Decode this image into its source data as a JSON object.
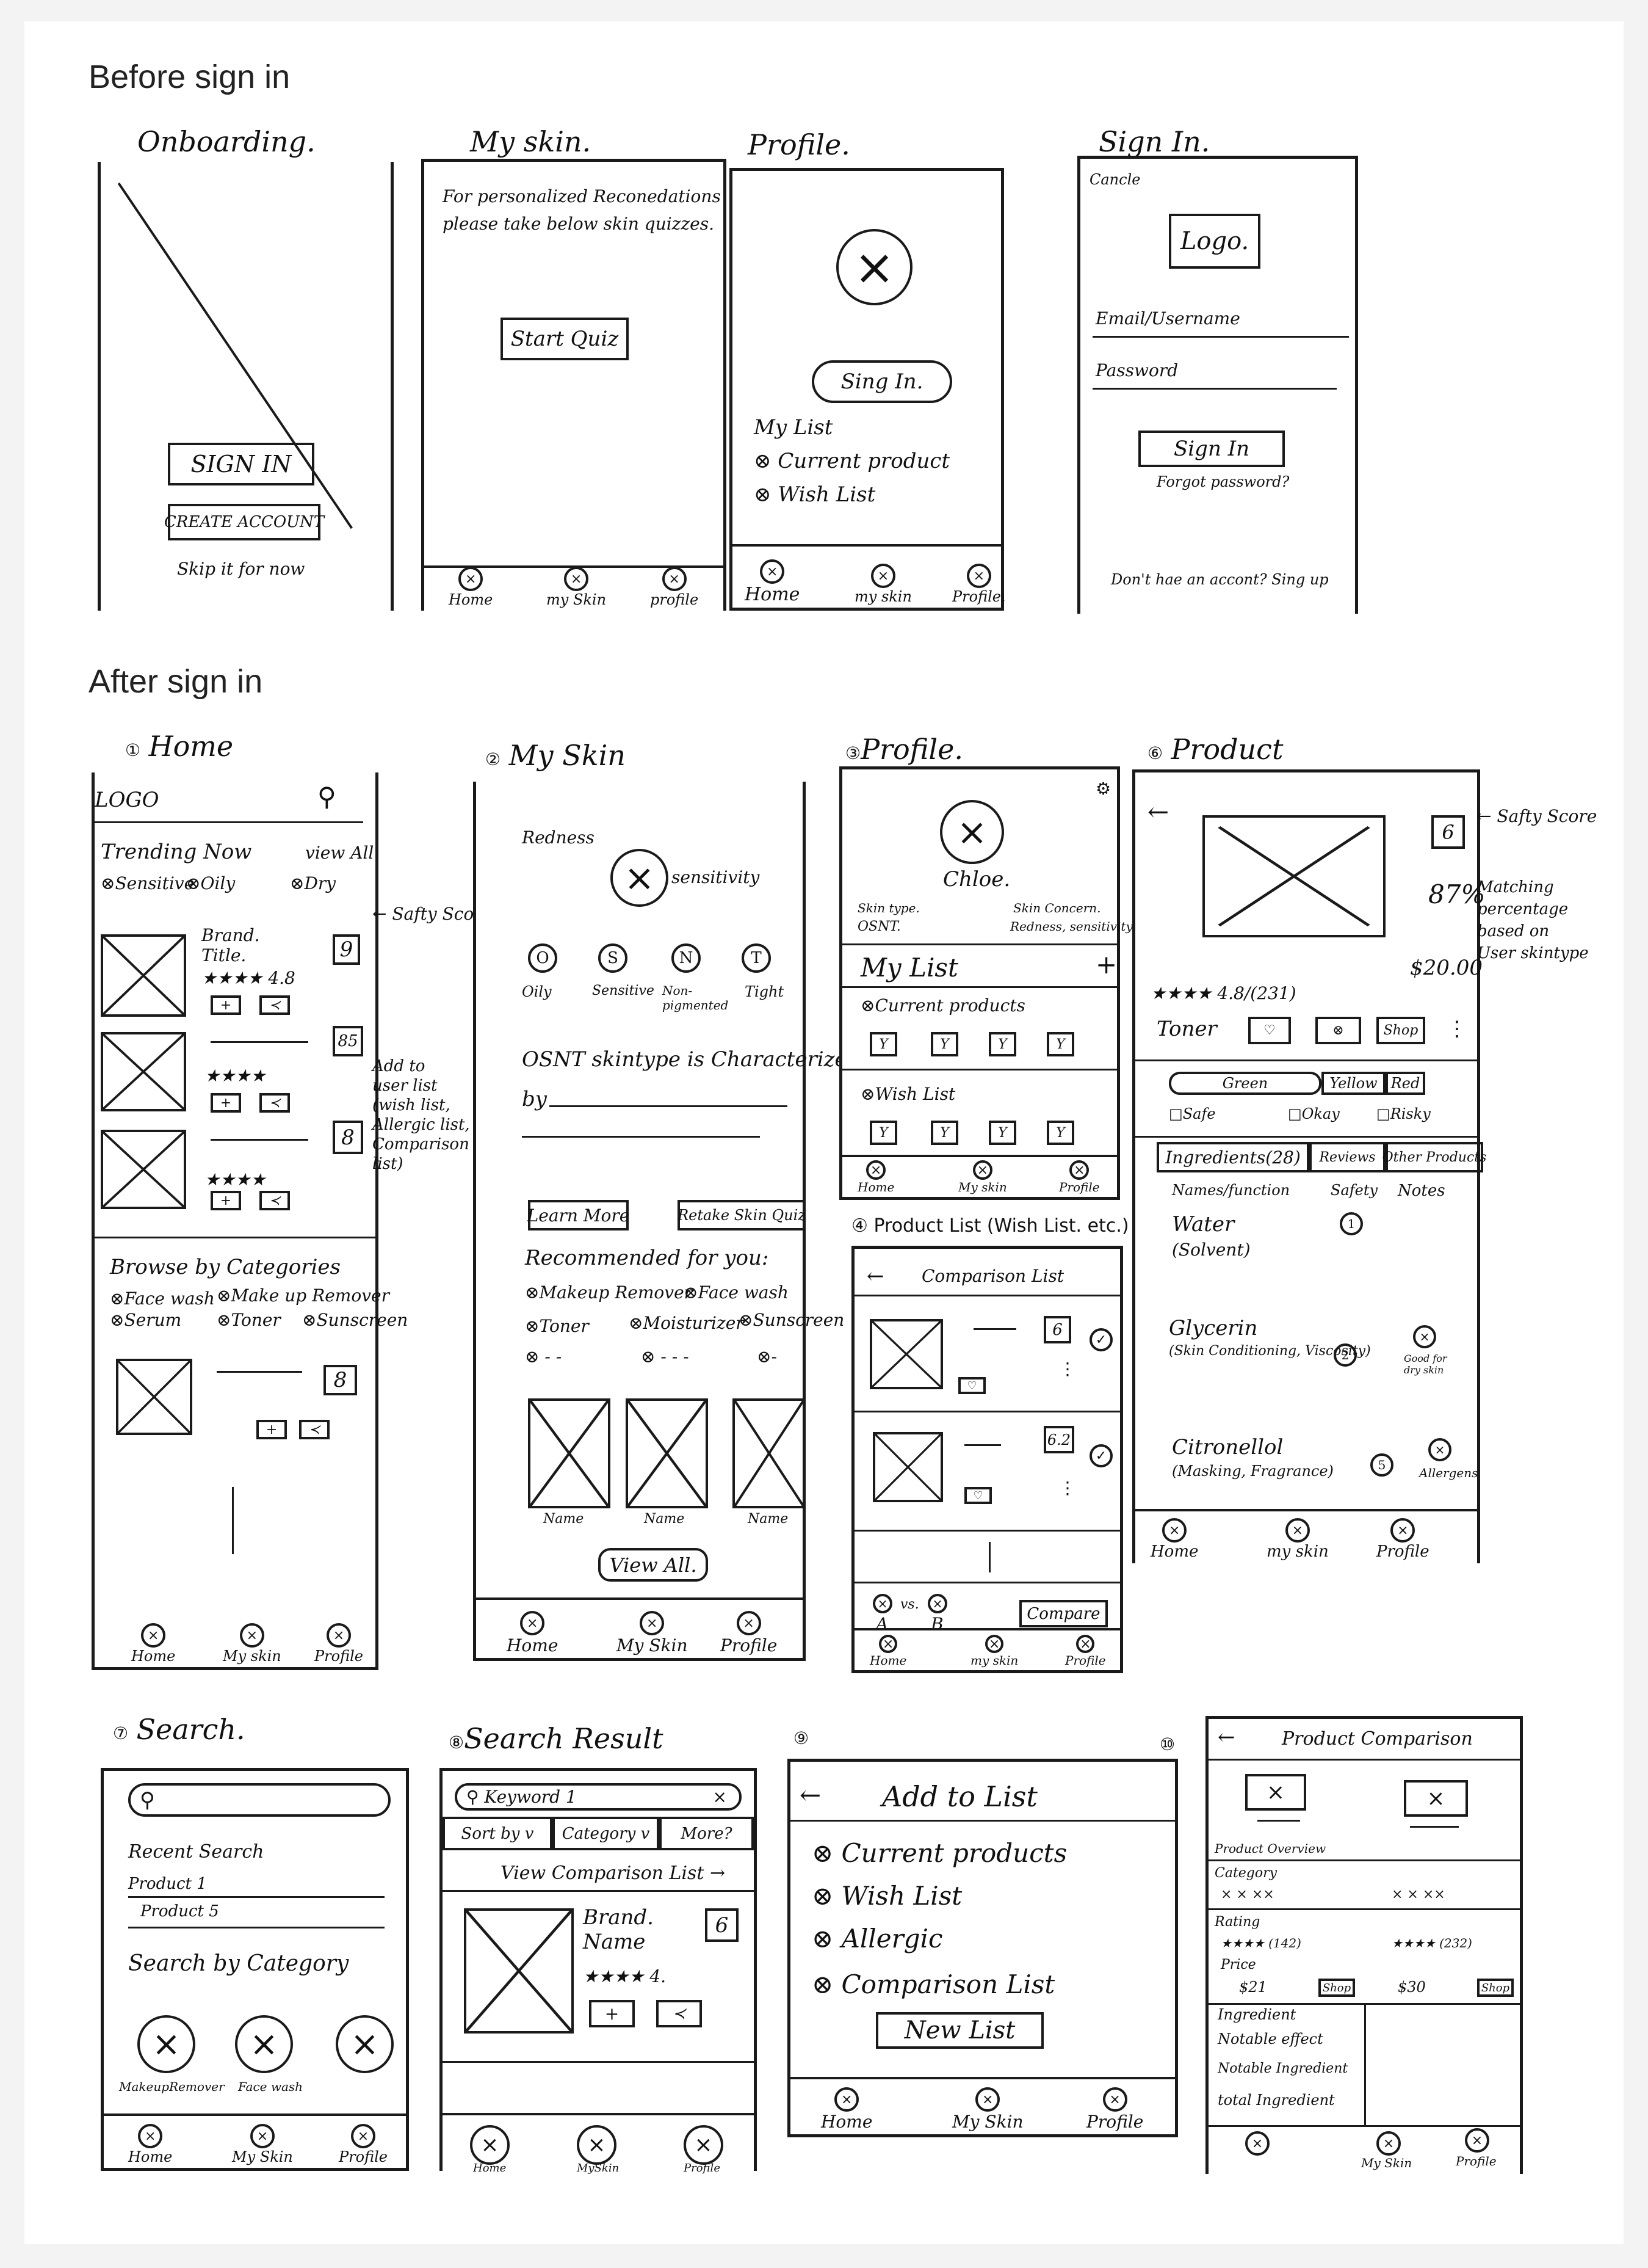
{
  "sections": {
    "before": "Before sign in",
    "after": "After sign in"
  },
  "onboarding": {
    "title": "Onboarding.",
    "sign_in": "SIGN IN",
    "create": "CREATE ACCOUNT",
    "skip": "Skip it for now",
    "nav": [
      "Home",
      "my Skin",
      "profile"
    ]
  },
  "myskin_before": {
    "title": "My skin.",
    "text1": "For personalized Reconedations",
    "text2": "please take below skin quizzes.",
    "start": "Start Quiz"
  },
  "profile_before": {
    "title": "Profile.",
    "sign_in": "Sing In.",
    "list_title": "My List",
    "items": [
      "Current product",
      "Wish List"
    ],
    "nav": [
      "Home",
      "my skin",
      "Profile."
    ]
  },
  "signin": {
    "title": "Sign In.",
    "cancel": "Cancle",
    "logo": "Logo.",
    "email": "Email/Username",
    "password": "Password",
    "button": "Sign In",
    "forgot": "Forgot password?",
    "signup": "Don't hae an accont? Sing up"
  },
  "home": {
    "title": "Home",
    "num": "①",
    "logo": "LOGO",
    "trending": "Trending Now",
    "view_all": "view All",
    "filters": [
      "Sensitive",
      "Oily",
      "Dry"
    ],
    "brand": "Brand.",
    "title_label": "Title.",
    "rating": "4.8",
    "scores": [
      "9",
      "85",
      "8",
      "8"
    ],
    "browse": "Browse by Categories",
    "cats": [
      "Face wash",
      "Make up Remover",
      "Serum",
      "Toner",
      "Sunscreen"
    ],
    "nav": [
      "Home",
      "My skin",
      "Profile"
    ]
  },
  "myskin_after": {
    "title": "My Skin",
    "num": "②",
    "redness": "Redness",
    "sensitivity": "sensitivity",
    "letters": [
      "O",
      "S",
      "N",
      "T"
    ],
    "types": [
      "Oily",
      "Sensitive",
      "Non-pigmented",
      "Tight"
    ],
    "desc": "OSNT skintype is Characterized",
    "by": "by",
    "learn": "Learn More",
    "retake": "Retake Skin Quiz",
    "recommended": "Recommended for you:",
    "cats": [
      "Makeup Remover",
      "Face wash",
      "Toner",
      "Moisturizer",
      "Sunscreen"
    ],
    "name": "Name",
    "view_all": "View All.",
    "nav": [
      "Home",
      "My Skin",
      "Profile"
    ]
  },
  "profile_after": {
    "title": "Profile.",
    "num": "③",
    "name": "Chloe.",
    "skintype_label": "Skin type.",
    "skintype": "OSNT.",
    "concern_label": "Skin Concern.",
    "concern": "Redness, sensitivity",
    "list_title": "My List",
    "current": "Current products",
    "wish": "Wish List",
    "nav": [
      "Home",
      "My skin",
      "Profile"
    ]
  },
  "product_list": {
    "title": "Product List (Wish List. etc.)",
    "num": "④",
    "header": "Comparison List",
    "scores": [
      "6",
      "6.2"
    ],
    "a": "A",
    "vs": "vs.",
    "b": "B",
    "compare": "Compare",
    "nav": [
      "Home",
      "my skin",
      "Profile"
    ]
  },
  "product": {
    "title": "Product",
    "num": "⑥",
    "score": "6",
    "match": "87%",
    "price": "$20.00",
    "rating": "4.8/(231)",
    "type": "Toner",
    "shop": "Shop",
    "levels": [
      "Green",
      "Yellow",
      "Red"
    ],
    "safety": [
      "Safe",
      "Okay",
      "Risky"
    ],
    "tabs": [
      "Ingredients(28)",
      "Reviews",
      "Other Products"
    ],
    "cols": [
      "Names/function",
      "Safety",
      "Notes"
    ],
    "ingredients": [
      {
        "name": "Water",
        "fn": "(Solvent)",
        "score": "1",
        "note": ""
      },
      {
        "name": "Glycerin",
        "fn": "(Skin Conditioning, Viscosity)",
        "score": "2",
        "note": "Good for dry skin"
      },
      {
        "name": "Citronellol",
        "fn": "(Masking, Fragrance)",
        "score": "5",
        "note": "Allergens"
      }
    ],
    "nav": [
      "Home",
      "my skin",
      "Profile"
    ]
  },
  "annotations": {
    "safety": "Safty Score",
    "add": [
      "Add to",
      "user list",
      "(wish list,",
      "Allergic list,",
      "Comparison",
      "list)"
    ],
    "matching": [
      "Matching",
      "percentage",
      "based on",
      "User skintype"
    ],
    "safety2": "Safty Score"
  },
  "search": {
    "title": "Search.",
    "num": "⑦",
    "recent": "Recent Search",
    "p1": "Product 1",
    "p2": "Product 5",
    "by_cat": "Search by Category",
    "cats": [
      "MakeupRemover",
      "Face wash",
      ""
    ],
    "nav": [
      "Home",
      "My Skin",
      "Profile"
    ]
  },
  "search_result": {
    "title": "Search Result",
    "num": "⑧",
    "keyword": "Keyword 1",
    "sort": "Sort by",
    "category": "Category",
    "more": "More?",
    "view_list": "View Comparison List →",
    "brand": "Brand.",
    "name": "Name",
    "score": "6",
    "rating": "4.",
    "nav": [
      "Home",
      "MySkin",
      "Profile"
    ]
  },
  "add_list": {
    "title": "Add to List",
    "num": "⑨",
    "items": [
      "Current products",
      "Wish List",
      "Allergic",
      "Comparison List"
    ],
    "new": "New List",
    "nav": [
      "Home",
      "My Skin",
      "Profile"
    ]
  },
  "comparison": {
    "title": "Product Comparison",
    "num": "⑩",
    "overview": "Product Overview",
    "category": "Category",
    "rating": "Rating",
    "price": "Price",
    "p1_rating": "(142)",
    "p2_rating": "(232)",
    "p1_price": "$21",
    "p2_price": "$30",
    "shop": "Shop",
    "ingredient": "Ingredient",
    "rows": [
      "Notable effect",
      "Notable Ingredient",
      "total Ingredient"
    ],
    "nav": [
      "",
      "My Skin",
      "Profile"
    ]
  }
}
